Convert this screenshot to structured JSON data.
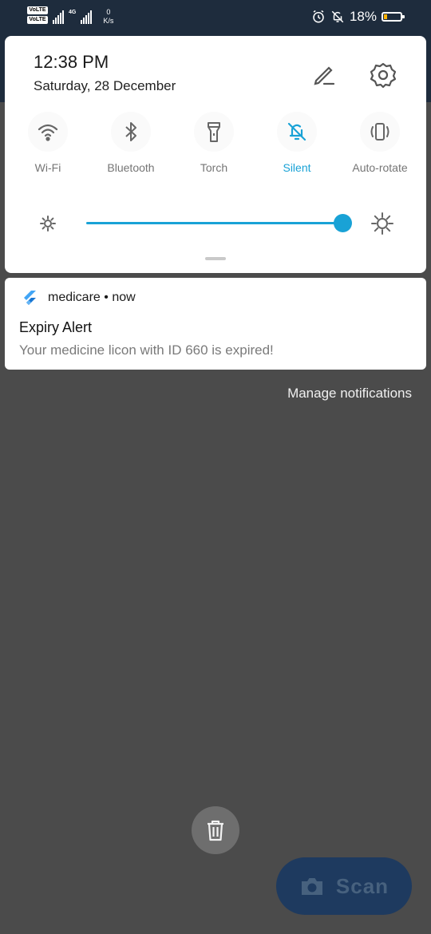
{
  "status_bar": {
    "volte_1": "VoLTE",
    "volte_2": "VoLTE",
    "net_type": "4G",
    "speed_value": "0",
    "speed_unit": "K/s",
    "battery": "18%",
    "battery_level": 0.18,
    "battery_color": "#ffb300"
  },
  "quick_settings": {
    "time": "12:38 PM",
    "date": "Saturday, 28 December",
    "edit_icon": "pencil-icon",
    "settings_icon": "gear-icon",
    "tiles": [
      {
        "label": "Wi-Fi",
        "icon": "wifi-icon",
        "active": false
      },
      {
        "label": "Bluetooth",
        "icon": "bluetooth-icon",
        "active": false
      },
      {
        "label": "Torch",
        "icon": "torch-icon",
        "active": false
      },
      {
        "label": "Silent",
        "icon": "bell-off-icon",
        "active": true
      },
      {
        "label": "Auto-rotate",
        "icon": "auto-rotate-icon",
        "active": false
      }
    ],
    "brightness_level": 0.98,
    "accent_color": "#19a2d6"
  },
  "notification": {
    "app_name": "medicare",
    "separator": "•",
    "time": "now",
    "title": "Expiry Alert",
    "body": "Your medicine licon with ID 660 is expired!"
  },
  "manage_notifications": "Manage notifications",
  "background_app": {
    "delete_icon": "trash-icon",
    "scan_label": "Scan",
    "scan_icon": "camera-icon"
  }
}
